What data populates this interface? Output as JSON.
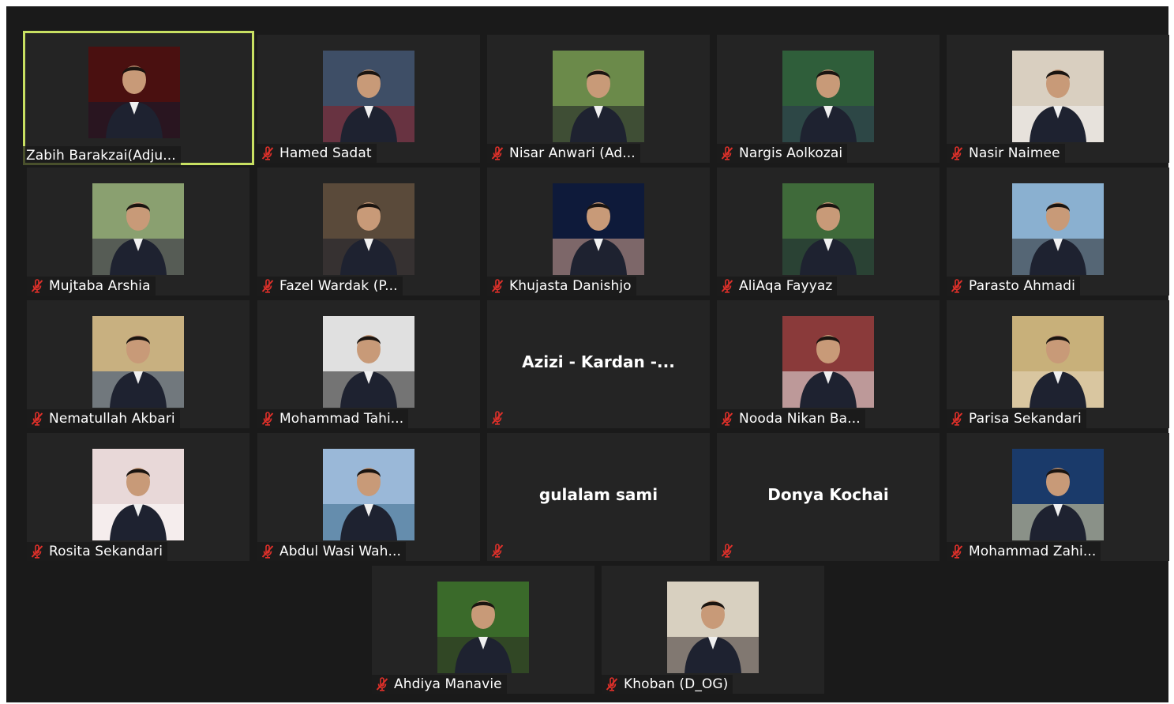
{
  "colors": {
    "background": "#1a1a1a",
    "tile": "#242424",
    "active_border": "#c8e062",
    "mute_icon": "#e0302a",
    "name_text": "#ffffff"
  },
  "participants": [
    {
      "name": "Zabih Barakzai(Adju...",
      "muted": false,
      "active": true,
      "has_video": true,
      "icon": "person-avatar"
    },
    {
      "name": "Hamed Sadat",
      "muted": true,
      "active": false,
      "has_video": true,
      "icon": "person-avatar"
    },
    {
      "name": "Nisar Anwari (Ad...",
      "muted": true,
      "active": false,
      "has_video": true,
      "icon": "person-avatar"
    },
    {
      "name": "Nargis Aolkozai",
      "muted": true,
      "active": false,
      "has_video": true,
      "icon": "person-avatar"
    },
    {
      "name": "Nasir Naimee",
      "muted": true,
      "active": false,
      "has_video": true,
      "icon": "person-avatar"
    },
    {
      "name": "Mujtaba Arshia",
      "muted": true,
      "active": false,
      "has_video": true,
      "icon": "person-avatar"
    },
    {
      "name": "Fazel Wardak (P...",
      "muted": true,
      "active": false,
      "has_video": true,
      "icon": "person-avatar"
    },
    {
      "name": "Khujasta Danishjo",
      "muted": true,
      "active": false,
      "has_video": true,
      "icon": "person-avatar"
    },
    {
      "name": "AliAqa Fayyaz",
      "muted": true,
      "active": false,
      "has_video": true,
      "icon": "person-avatar"
    },
    {
      "name": "Parasto Ahmadi",
      "muted": true,
      "active": false,
      "has_video": true,
      "icon": "person-avatar"
    },
    {
      "name": "Nematullah Akbari",
      "muted": true,
      "active": false,
      "has_video": true,
      "icon": "person-avatar"
    },
    {
      "name": "Mohammad Tahi...",
      "muted": true,
      "active": false,
      "has_video": true,
      "icon": "person-avatar"
    },
    {
      "name": "Azizi  -  Kardan  -...",
      "muted": true,
      "active": false,
      "has_video": false,
      "icon": "mic-muted-icon"
    },
    {
      "name": "Nooda Nikan Ba...",
      "muted": true,
      "active": false,
      "has_video": true,
      "icon": "person-avatar"
    },
    {
      "name": "Parisa Sekandari",
      "muted": true,
      "active": false,
      "has_video": true,
      "icon": "person-avatar"
    },
    {
      "name": "Rosita Sekandari",
      "muted": true,
      "active": false,
      "has_video": true,
      "icon": "person-avatar"
    },
    {
      "name": "Abdul Wasi Wah...",
      "muted": true,
      "active": false,
      "has_video": true,
      "icon": "person-avatar"
    },
    {
      "name": "gulalam sami",
      "muted": true,
      "active": false,
      "has_video": false,
      "icon": "mic-muted-icon"
    },
    {
      "name": "Donya Kochai",
      "muted": true,
      "active": false,
      "has_video": false,
      "icon": "mic-muted-icon"
    },
    {
      "name": "Mohammad Zahi...",
      "muted": true,
      "active": false,
      "has_video": true,
      "icon": "person-avatar"
    },
    {
      "name": "Ahdiya Manavie",
      "muted": true,
      "active": false,
      "has_video": true,
      "icon": "person-avatar"
    },
    {
      "name": "Khoban (D_OG)",
      "muted": true,
      "active": false,
      "has_video": true,
      "icon": "person-avatar"
    }
  ]
}
